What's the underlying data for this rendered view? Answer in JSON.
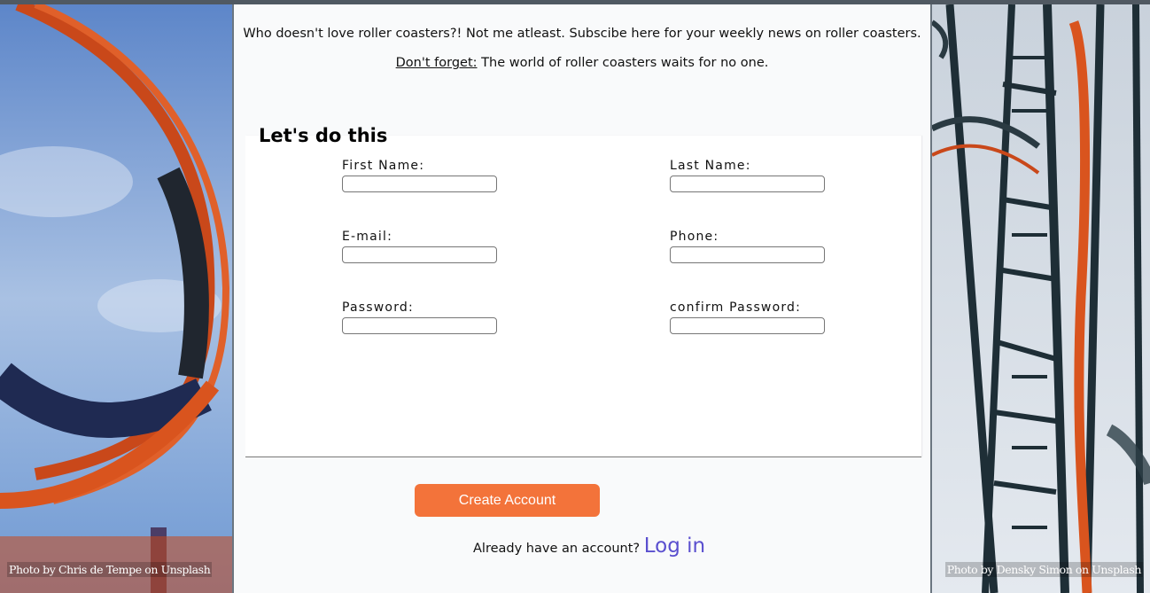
{
  "intro": {
    "line1": "Who doesn't love roller coasters?! Not me atleast. Subscibe here for your weekly news on roller coasters.",
    "reminder_label": "Don't forget:",
    "reminder_text": " The world of roller coasters waits for no one."
  },
  "form": {
    "title": "Let's do this",
    "fields": {
      "first_name": "First Name:",
      "last_name": "Last Name:",
      "email": "E-mail:",
      "phone": "Phone:",
      "password": "Password:",
      "confirm_password": "confirm Password:"
    },
    "values": {
      "first_name": "",
      "last_name": "",
      "email": "",
      "phone": "",
      "password": "",
      "confirm_password": ""
    }
  },
  "actions": {
    "create_account": "Create Account",
    "already_text": "Already have an account? ",
    "login_link": "Log in"
  },
  "photos": {
    "left_credit": "Photo by Chris de Tempe on Unsplash",
    "right_credit": "Photo by Densky Simon on Unsplash"
  },
  "colors": {
    "accent_button": "#f3733a",
    "link": "#5a4fcf",
    "coaster_track": "#d9541e"
  }
}
